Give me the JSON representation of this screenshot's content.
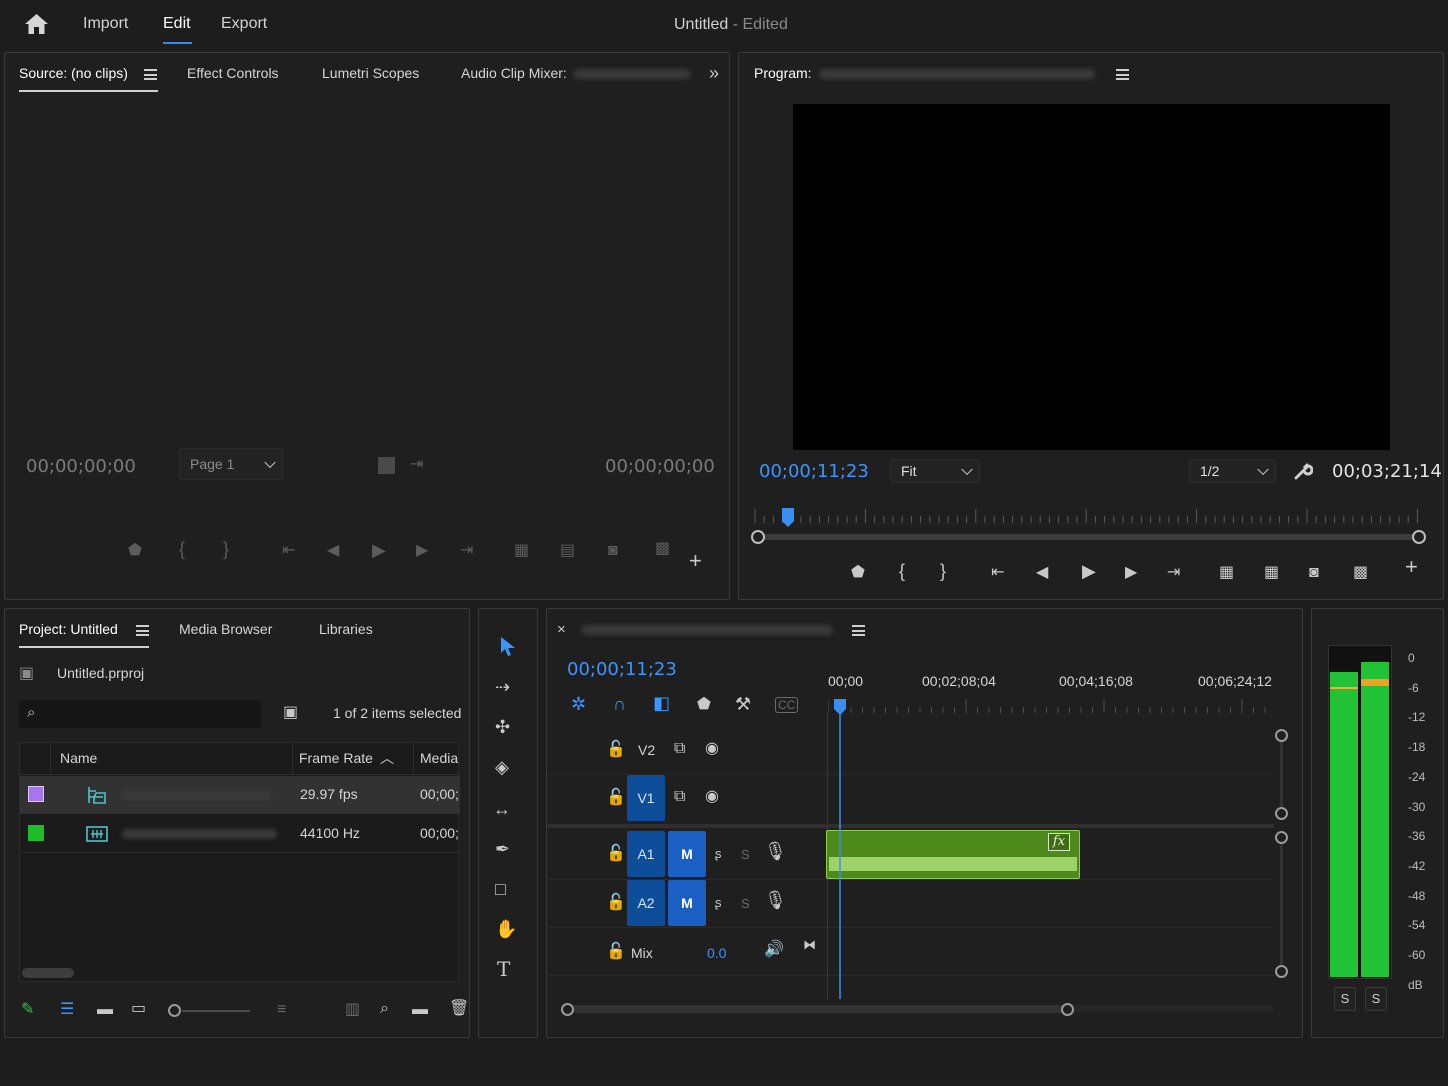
{
  "app": {
    "nav": {
      "import": "Import",
      "edit": "Edit",
      "export": "Export"
    },
    "title": "Untitled",
    "title_status": "- Edited"
  },
  "source_panel": {
    "tabs": [
      "Source: (no clips)",
      "Effect Controls",
      "Lumetri Scopes",
      "Audio Clip Mixer:"
    ],
    "timecode_left": "00;00;00;00",
    "timecode_right": "00;00;00;00",
    "page_select": "Page 1"
  },
  "program_panel": {
    "label": "Program:",
    "timecode_current": "00;00;11;23",
    "timecode_duration": "00;03;21;14",
    "fit_select": "Fit",
    "resolution_select": "1/2"
  },
  "project_panel": {
    "tabs": [
      "Project: Untitled",
      "Media Browser",
      "Libraries"
    ],
    "project_file": "Untitled.prproj",
    "selection_status": "1 of 2 items selected",
    "columns": [
      "Name",
      "Frame Rate",
      "Media"
    ],
    "rows": [
      {
        "color": "#a874f0",
        "frame_rate": "29.97 fps",
        "media": "00;00;"
      },
      {
        "color": "#1fbe29",
        "frame_rate": "44100 Hz",
        "media": "00;00;"
      }
    ]
  },
  "timeline": {
    "close": "×",
    "timecode": "00;00;11;23",
    "ruler": [
      "00;00",
      "00;02;08;04",
      "00;04;16;08",
      "00;06;24;12"
    ],
    "tracks": {
      "v2": "V2",
      "v1": "V1",
      "a1": "A1",
      "a2": "A2",
      "mute": "M",
      "solo": "S",
      "mix": "Mix",
      "mix_value": "0.0"
    },
    "clip_fx": "fx"
  },
  "audio_meter": {
    "scale": [
      "0",
      "-6",
      "-12",
      "-18",
      "-24",
      "-30",
      "-36",
      "-42",
      "-48",
      "-54",
      "-60",
      "dB"
    ],
    "solo_left": "S",
    "solo_right": "S",
    "levels": [
      0.93,
      0.96
    ]
  },
  "colors": {
    "accent": "#2d8ceb",
    "timecode": "#2d8ceb",
    "clip": "#4f8a1e",
    "meter": "#22c23a"
  }
}
